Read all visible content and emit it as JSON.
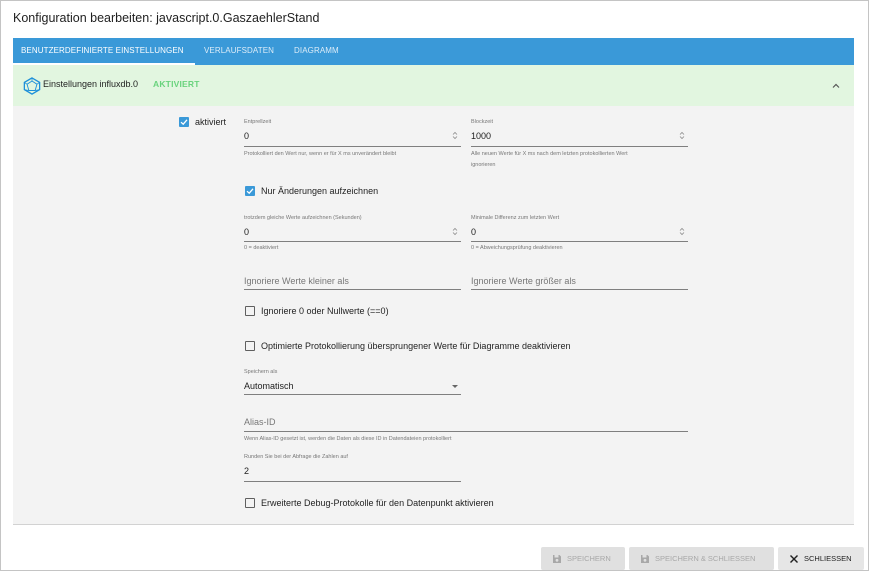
{
  "dialog": {
    "title": "Konfiguration bearbeiten: javascript.0.GaszaehlerStand"
  },
  "tabs": [
    {
      "label": "BENUTZERDEFINIERTE EINSTELLUNGEN",
      "active": true
    },
    {
      "label": "VERLAUFSDATEN",
      "active": false
    },
    {
      "label": "DIAGRAMM",
      "active": false
    }
  ],
  "panel": {
    "title": "Einstellungen influxdb.0",
    "status": "AKTIVIERT",
    "icon": "influxdb-icon"
  },
  "settings": {
    "enabled": {
      "label": "aktiviert",
      "checked": true
    },
    "debounce": {
      "label": "Entprellzeit",
      "value": "0",
      "help": "Protokolliert den Wert nur, wenn er für X ms unverändert bleibt"
    },
    "blocktime": {
      "label": "Blockzeit",
      "value": "1000",
      "help_line1": "Alle neuen Werte für X ms nach dem letzten protokollierten Wert",
      "help_line2": "ignorieren"
    },
    "changes_only": {
      "label": "Nur Änderungen aufzeichnen",
      "checked": true
    },
    "same_values": {
      "label": "trotzdem gleiche Werte aufzeichnen (Sekunden)",
      "value": "0",
      "help": "0 = deaktiviert"
    },
    "min_diff": {
      "label": "Minimale Differenz zum letzten Wert",
      "value": "0",
      "help": "0 = Abweichungsprüfung deaktivieren"
    },
    "ignore_below": {
      "placeholder": "Ignoriere Werte kleiner als"
    },
    "ignore_above": {
      "placeholder": "Ignoriere Werte größer als"
    },
    "ignore_zero": {
      "label": "Ignoriere 0 oder Nullwerte (==0)",
      "checked": false
    },
    "disable_skipped": {
      "label": "Optimierte Protokollierung übersprungener Werte für Diagramme deaktivieren",
      "checked": false
    },
    "store_as": {
      "label": "Speichern als",
      "value": "Automatisch"
    },
    "alias": {
      "placeholder": "Alias-ID",
      "help": "Wenn Alias-ID gesetzt ist, werden die Daten als diese ID in Datendateien protokolliert"
    },
    "round": {
      "label": "Runden Sie bei der Abfrage die Zahlen auf",
      "value": "2"
    },
    "debug": {
      "label": "Erweiterte Debug-Protokolle für den Datenpunkt aktivieren",
      "checked": false
    }
  },
  "buttons": {
    "save": "SPEICHERN",
    "save_close": "SPEICHERN & SCHLIESSEN",
    "close": "SCHLIESSEN"
  },
  "colors": {
    "tab_bar": "#3a99d8",
    "panel_header": "#e2f6e0",
    "status_green": "#69d37d",
    "checkbox_on": "#3a99d8"
  }
}
